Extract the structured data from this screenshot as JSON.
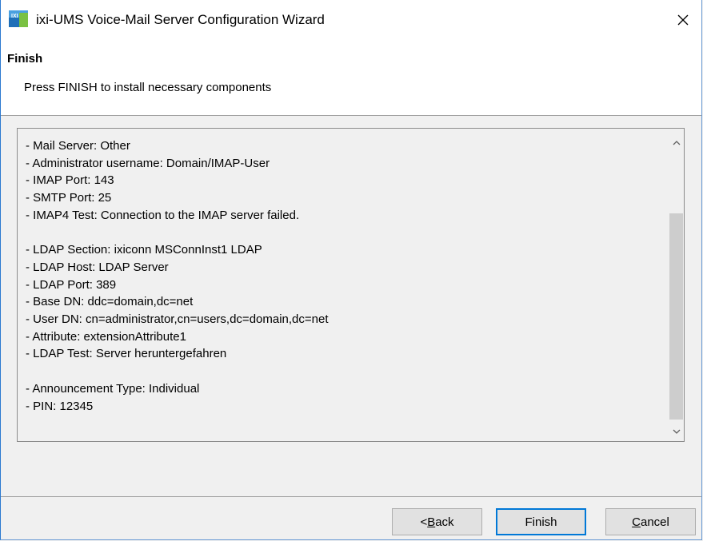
{
  "window": {
    "title": "ixi-UMS Voice-Mail Server Configuration Wizard",
    "app_icon": "ixi-ums-app-icon",
    "close_icon": "close-icon"
  },
  "header": {
    "title": "Finish",
    "subtitle": "Press FINISH to install necessary components"
  },
  "summary": {
    "lines": [
      "- Mail Server: Other",
      "- Administrator username: Domain/IMAP-User",
      "- IMAP Port: 143",
      "- SMTP Port: 25",
      "- IMAP4 Test: Connection to the IMAP server failed.",
      "",
      "- LDAP Section: ixiconn MSConnInst1 LDAP",
      "- LDAP Host: LDAP Server",
      "- LDAP Port: 389",
      "- Base DN: ddc=domain,dc=net",
      "- User DN: cn=administrator,cn=users,dc=domain,dc=net",
      "- Attribute: extensionAttribute1",
      "- LDAP Test: Server heruntergefahren",
      "",
      "- Announcement Type: Individual",
      "- PIN: 12345"
    ]
  },
  "buttons": {
    "back_prefix": "< ",
    "back_access": "B",
    "back_rest": "ack",
    "finish": "Finish",
    "cancel_access": "C",
    "cancel_rest": "ancel"
  },
  "colors": {
    "accent": "#0078d7",
    "title_bar_border": "#2b79d0"
  }
}
